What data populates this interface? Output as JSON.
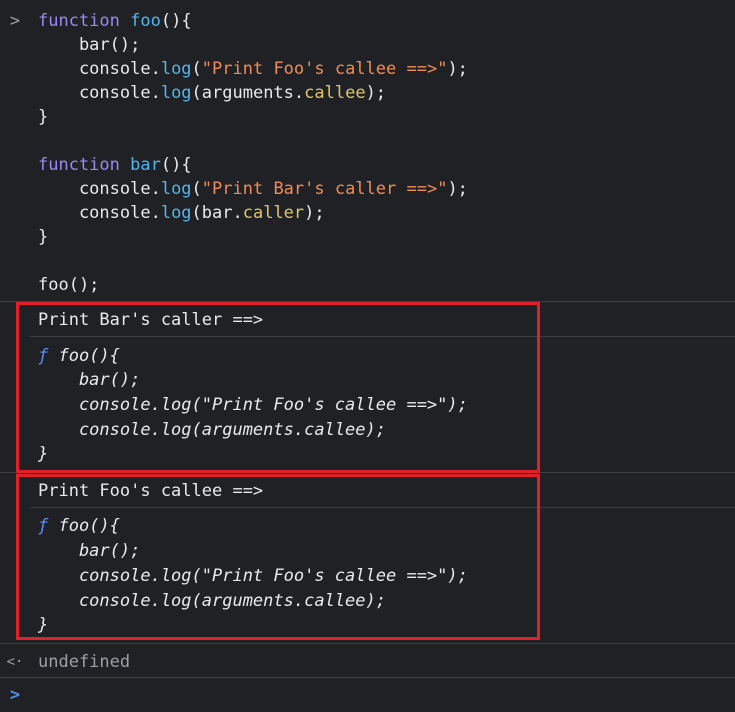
{
  "input_caret": ">",
  "return_caret": "<·",
  "prompt_caret": ">",
  "code": {
    "l1": {
      "kw": "function",
      "name": "foo",
      "rest": "(){"
    },
    "l2": "    bar();",
    "l3": {
      "pre": "    console.",
      "fn": "log",
      "open": "(",
      "str": "\"Print Foo's callee ==>\"",
      "close": ");"
    },
    "l4": {
      "pre": "    console.",
      "fn": "log",
      "open": "(arguments.",
      "prop": "callee",
      "close": ");"
    },
    "l5": "}",
    "l7": {
      "kw": "function",
      "name": "bar",
      "rest": "(){"
    },
    "l8": {
      "pre": "    console.",
      "fn": "log",
      "open": "(",
      "str": "\"Print Bar's caller ==>\"",
      "close": ");"
    },
    "l9": {
      "pre": "    console.",
      "fn": "log",
      "open": "(bar.",
      "prop": "caller",
      "close": ");"
    },
    "l10": "}",
    "l12": "foo();"
  },
  "output1": {
    "label": "Print Bar's caller ==>",
    "f": "ƒ",
    "lines": [
      " foo(){",
      "    bar();",
      "    console.log(\"Print Foo's callee ==>\");",
      "    console.log(arguments.callee);",
      "}"
    ]
  },
  "output2": {
    "label": "Print Foo's callee ==>",
    "f": "ƒ",
    "lines": [
      " foo(){",
      "    bar();",
      "    console.log(\"Print Foo's callee ==>\");",
      "    console.log(arguments.callee);",
      "}"
    ]
  },
  "result": "undefined",
  "colors": {
    "highlight": "#e0202a",
    "keyword": "#9b87f5",
    "function": "#4fb6f2",
    "string": "#f28b54",
    "property": "#dcc86a"
  }
}
